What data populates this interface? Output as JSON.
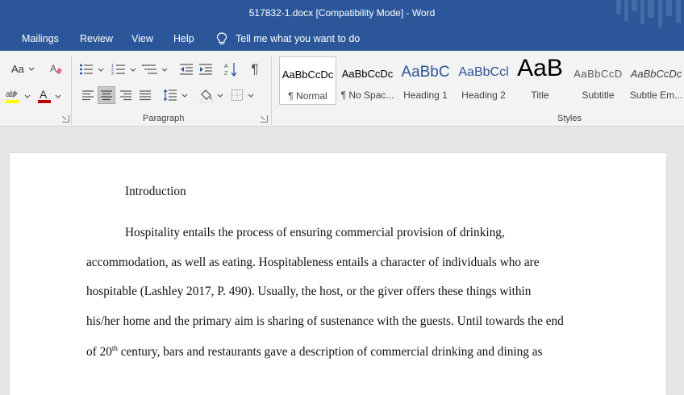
{
  "window": {
    "title": "517832-1.docx [Compatibility Mode]  -  Word"
  },
  "tabs": [
    "Mailings",
    "Review",
    "View",
    "Help"
  ],
  "tell_me": {
    "text": "Tell me what you want to do"
  },
  "ribbon": {
    "font_size_btn": "Aa",
    "groups": {
      "paragraph": "Paragraph",
      "styles": "Styles"
    },
    "styles": [
      {
        "sample": "AaBbCcDc",
        "label": "¶ Normal"
      },
      {
        "sample": "AaBbCcDc",
        "label": "¶ No Spac..."
      },
      {
        "sample": "AaBbC",
        "label": "Heading 1"
      },
      {
        "sample": "AaBbCcl",
        "label": "Heading 2"
      },
      {
        "sample": "AaB",
        "label": "Title"
      },
      {
        "sample": "AaBbCcD",
        "label": "Subtitle"
      },
      {
        "sample": "AaBbCcDc",
        "label": "Subtle Em..."
      }
    ]
  },
  "document": {
    "heading": "Introduction",
    "lines": [
      "Hospitality entails the process of ensuring commercial provision of drinking,",
      "accommodation, as well as eating. Hospitableness entails a character of individuals who are",
      "hospitable (Lashley 2017, P. 490). Usually, the host, or the giver offers these things within",
      "his/her home and the primary aim is sharing of sustenance with the guests. Until towards the end"
    ],
    "last_line_pre": "of 20",
    "last_line_sup": "th",
    "last_line_post": " century, bars and restaurants gave a description of commercial drinking and dining as"
  },
  "colors": {
    "accent": "#2b579a",
    "highlight": "#ffff00",
    "font_color": "#c00000"
  }
}
